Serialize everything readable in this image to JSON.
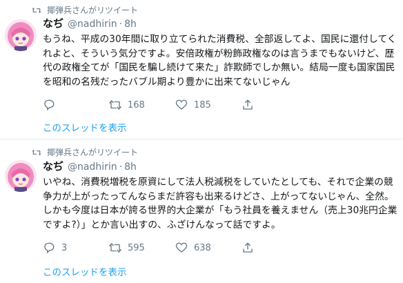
{
  "tweets": [
    {
      "retweet_label": "揶弾兵さんがリツイート",
      "author_name": "なぢ",
      "handle": "",
      "dot": "·",
      "time": "8h",
      "text": "もうね、平成の30年間に取り立てられた消費税、全部返してよ、国民に還付してくれよと、そういう気分ですよ。安倍政権が粉飾政権なのは言うまでもないけど、歴代の政権全てが「国民を騙し続けて来た」詐欺師でしか無い。結局一度も国家国民を昭和の名残だったバブル期より豊かに出来てないじゃん",
      "replies": "",
      "retweets": "168",
      "likes": "185",
      "thread_link": "このスレッドを表示"
    },
    {
      "retweet_label": "揶弾兵さんがリツイート",
      "author_name": "なぢ",
      "handle": "@nadhirin",
      "dot": "·",
      "time": "8h",
      "text": "いやね、消費税増税を原資にして法人税減税をしていたとしても、それで企業の競争力が上がったってんならまだ許容も出来るけどさ、上がってないじゃん、全然。しかも今度は日本が誇る世界的大企業が「もう社員を養えません（売上30兆円企業ですよ?）」とか言い出すの、ふざけんなって話ですよ。",
      "replies": "3",
      "retweets": "595",
      "likes": "638",
      "thread_link": "このスレッドを表示"
    }
  ],
  "tweet1_handle_shown": "@nadhirin",
  "colors": {
    "accent": "#1da1f2",
    "secondary_text": "#657786",
    "primary_text": "#14171a",
    "divider": "#e6ecf0"
  },
  "icons": [
    "retweet-icon",
    "reply-icon",
    "heart-icon",
    "share-icon"
  ]
}
